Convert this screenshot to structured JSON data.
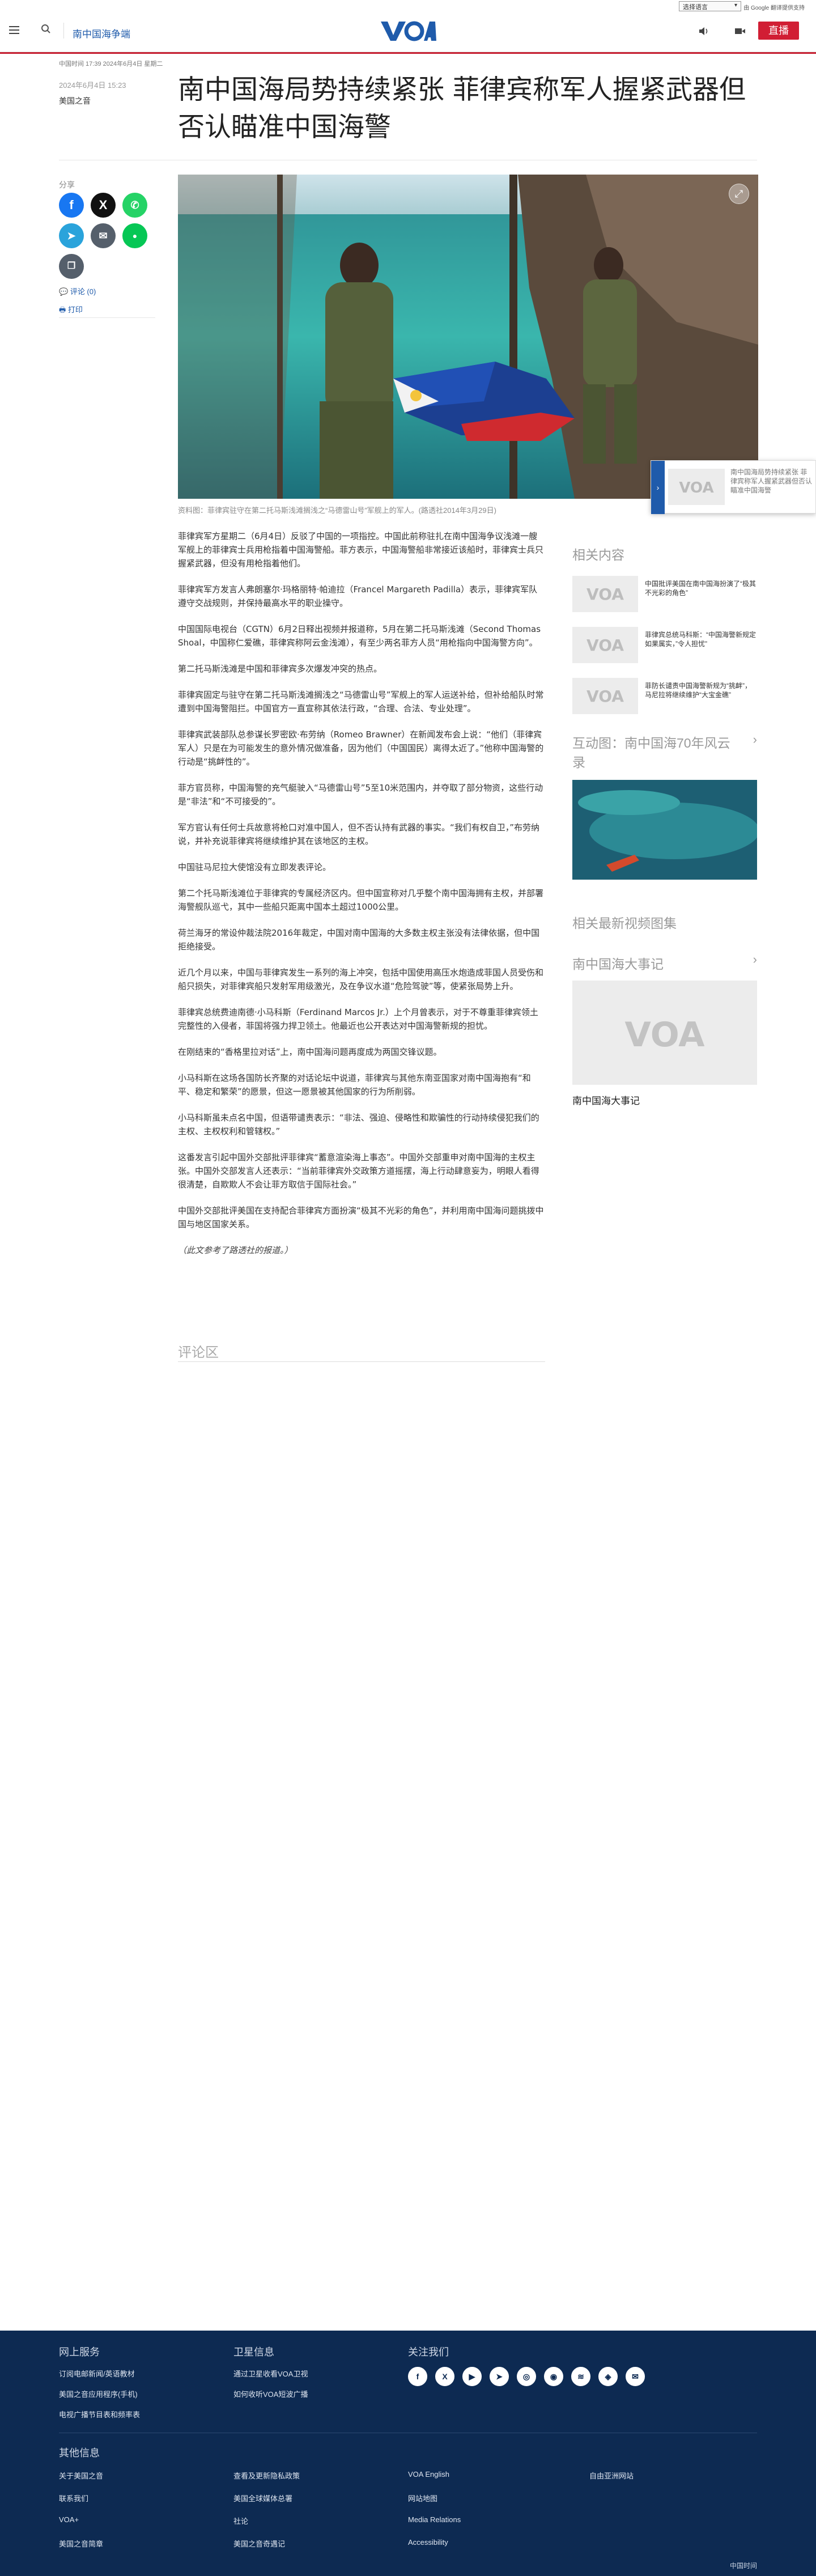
{
  "top_bar": {
    "language_select": "选择语言",
    "powered_by": "由 Google 翻译提供支持"
  },
  "header": {
    "section": "南中国海争端",
    "logo_text": "VOA",
    "live_label": "直播"
  },
  "article": {
    "published": "中国时间 17:39 2024年6月4日 星期二",
    "date": "2024年6月4日 15:23",
    "author": "美国之音",
    "title": "南中国海局势持续紧张 菲律宾称军人握紧武器但否认瞄准中国海警",
    "share_label": "分享",
    "comments_link": "评论 (0)",
    "print_link": "打印",
    "caption": "资料图：菲律宾驻守在第二托马斯浅滩搁浅之“马德雷山号”军舰上的军人。(路透社2014年3月29日)",
    "paragraphs": [
      "菲律宾军方星期二（6月4日）反驳了中国的一项指控。中国此前称驻扎在南中国海争议浅滩一艘军舰上的菲律宾士兵用枪指着中国海警船。菲方表示，中国海警船非常接近该船时，菲律宾士兵只握紧武器，但没有用枪指着他们。",
      "菲律宾军方发言人弗朗塞尔·玛格丽特·帕迪拉（Francel Margareth Padilla）表示，菲律宾军队遵守交战规则，并保持最高水平的职业操守。",
      "中国国际电视台（CGTN）6月2日释出视频并报道称，5月在第二托马斯浅滩（Second Thomas Shoal，中国称仁爱礁，菲律宾称阿云金浅滩），有至少两名菲方人员“用枪指向中国海警方向”。",
      "第二托马斯浅滩是中国和菲律宾多次爆发冲突的热点。",
      "菲律宾固定与驻守在第二托马斯浅滩搁浅之“马德雷山号”军舰上的军人运送补给，但补给船队时常遭到中国海警阻拦。中国官方一直宣称其依法行政，“合理、合法、专业处理”。",
      "菲律宾武装部队总参谋长罗密欧·布劳纳（Romeo Brawner）在新闻发布会上说：“他们（菲律宾军人）只是在为可能发生的意外情况做准备，因为他们（中国国民）离得太近了。”他称中国海警的行动是“挑衅性的”。",
      "菲方官员称，中国海警的充气艇驶入“马德雷山号”5至10米范围内，并夺取了部分物资，这些行动是“非法”和“不可接受的”。",
      "军方官认有任何士兵故意将枪口对准中国人，但不否认持有武器的事实。“我们有权自卫，”布劳纳说，并补充说菲律宾将继续维护其在该地区的主权。",
      "中国驻马尼拉大使馆没有立即发表评论。",
      "第二个托马斯浅滩位于菲律宾的专属经济区内。但中国宣称对几乎整个南中国海拥有主权，并部署海警舰队巡弋，其中一些船只距离中国本土超过1000公里。",
      "荷兰海牙的常设仲裁法院2016年裁定，中国对南中国海的大多数主权主张没有法律依据，但中国拒绝接受。",
      "近几个月以来，中国与菲律宾发生一系列的海上冲突，包括中国使用高压水炮造成菲国人员受伤和船只损失，对菲律宾船只发射军用级激光，及在争议水道“危险驾驶”等，使紧张局势上升。",
      "菲律宾总统费迪南德·小马科斯（Ferdinand Marcos Jr.）上个月曾表示，对于不尊重菲律宾领土完整性的入侵者，菲国将强力捍卫领土。他最近也公开表达对中国海警新规的担忧。",
      "在刚结束的“香格里拉对话”上，南中国海问题再度成为两国交锋议题。",
      "小马科斯在这场各国防长齐聚的对话论坛中说道，菲律宾与其他东南亚国家对南中国海抱有“和平、稳定和繁荣”的愿景，但这一愿景被其他国家的行为所削弱。",
      "小马科斯虽未点名中国，但语带谴责表示：“非法、强迫、侵略性和欺骗性的行动持续侵犯我们的主权、主权权利和管辖权。”",
      "这番发言引起中国外交部批评菲律宾“蓄意渲染海上事态”。中国外交部重申对南中国海的主权主张。中国外交部发言人还表示：“当前菲律宾外交政策方道摇摆，海上行动肆意妄为，明眼人看得很清楚，自欺欺人不会让菲方取信于国际社会。”",
      "中国外交部批评美国在支持配合菲律宾方面扮演“极其不光彩的角色”，并利用南中国海问题挑拨中国与地区国家关系。",
      "（此文参考了路透社的报道。）"
    ],
    "comments_title": "评论区"
  },
  "floating_card": {
    "text": "南中国海局势持续紧张 菲律宾称军人握紧武器但否认瞄准中国海警"
  },
  "sidebar": {
    "related_title": "相关内容",
    "related": [
      {
        "text": "中国批评美国在南中国海扮演了“极其不光彩的角色”"
      },
      {
        "text": "菲律宾总统马科斯：“中国海警新规定如果属实，”令人担忧”"
      },
      {
        "text": "菲防长谴责中国海警新规为“挑衅”，马尼拉将继续维护“大宝金礁”"
      }
    ],
    "interactive_title": "互动图：南中国海70年风云录",
    "video_title": "相关最新视频图集",
    "events_title": "南中国海大事记",
    "events_caption": "南中国海大事记"
  },
  "footer": {
    "col1_title": "网上服务",
    "col1_links": [
      "订阅电邮新闻/英语教材",
      "美国之音应用程序(手机)",
      "电视广播节目表和频率表"
    ],
    "col2_title": "卫星信息",
    "col2_links": [
      "通过卫星收看VOA卫视",
      "如何收听VOA短波广播"
    ],
    "col3_title": "关注我们",
    "other_title": "其他信息",
    "other_col1": [
      "关于美国之音",
      "联系我们",
      "VOA+",
      "美国之音简章"
    ],
    "other_col2": [
      "查看及更新隐私政策",
      "美国全球媒体总署",
      "社论",
      "美国之音奇遇记"
    ],
    "other_col3": [
      "VOA English",
      "网站地图",
      "Media Relations",
      "Accessibility"
    ],
    "other_col4": [
      "自由亚洲网站"
    ],
    "copyright": "中国时间"
  },
  "colors": {
    "brand_blue": "#1f5bab",
    "live_red": "#d11e34",
    "footer_bg": "#0d2a52",
    "facebook": "#1877f2",
    "x": "#111111",
    "whatsapp": "#25d366",
    "telegram": "#2aa3db",
    "email": "#555f6b",
    "line": "#06c755",
    "copy": "#555f6b"
  }
}
